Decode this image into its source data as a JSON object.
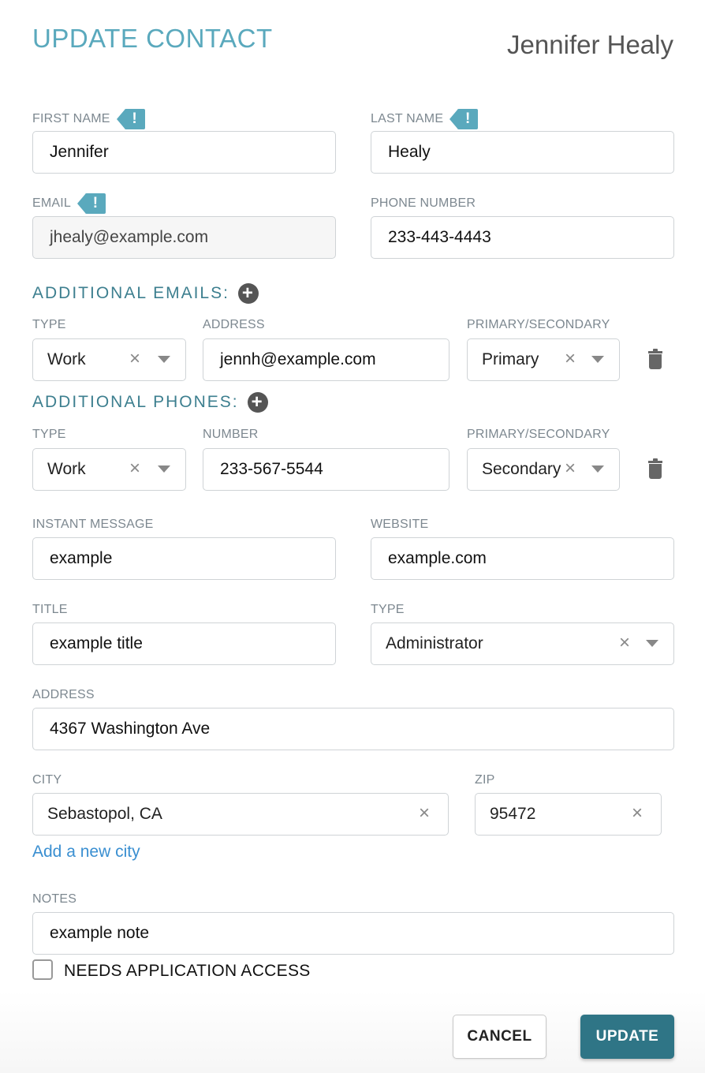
{
  "header": {
    "title": "UPDATE CONTACT",
    "contact_name": "Jennifer Healy"
  },
  "first_name": {
    "label": "FIRST NAME",
    "value": "Jennifer",
    "flag": "!"
  },
  "last_name": {
    "label": "LAST NAME",
    "value": "Healy",
    "flag": "!"
  },
  "email": {
    "label": "EMAIL",
    "value": "jhealy@example.com",
    "flag": "!"
  },
  "phone_number": {
    "label": "PHONE NUMBER",
    "value": "233-443-4443"
  },
  "additional_emails": {
    "heading": "ADDITIONAL EMAILS:",
    "col_type": "TYPE",
    "col_address": "ADDRESS",
    "col_primary": "PRIMARY/SECONDARY",
    "rows": [
      {
        "type": "Work",
        "address": "jennh@example.com",
        "primary": "Primary"
      }
    ]
  },
  "additional_phones": {
    "heading": "ADDITIONAL PHONES:",
    "col_type": "TYPE",
    "col_number": "NUMBER",
    "col_primary": "PRIMARY/SECONDARY",
    "rows": [
      {
        "type": "Work",
        "number": "233-567-5544",
        "primary": "Secondary"
      }
    ]
  },
  "instant_message": {
    "label": "INSTANT MESSAGE",
    "value": "example"
  },
  "website": {
    "label": "WEBSITE",
    "value": "example.com"
  },
  "title_field": {
    "label": "TITLE",
    "value": "example title"
  },
  "type_field": {
    "label": "TYPE",
    "value": "Administrator"
  },
  "address": {
    "label": "ADDRESS",
    "value": "4367 Washington Ave"
  },
  "city": {
    "label": "CITY",
    "value": "Sebastopol, CA",
    "add_link": "Add a new city"
  },
  "zip": {
    "label": "ZIP",
    "value": "95472"
  },
  "notes": {
    "label": "NOTES",
    "value": "example note"
  },
  "needs_access": {
    "label": "NEEDS APPLICATION ACCESS",
    "checked": false
  },
  "buttons": {
    "cancel": "CANCEL",
    "update": "UPDATE"
  },
  "icons": {
    "clear": "×",
    "flag": "exclamation-flag-icon",
    "add": "plus-circle-icon",
    "delete": "trash-icon",
    "dropdown": "caret-down-icon"
  },
  "colors": {
    "accent": "#5aa9bd",
    "section_heading": "#3d7f8f",
    "primary_button": "#2f7586",
    "link": "#3a8fd1"
  }
}
